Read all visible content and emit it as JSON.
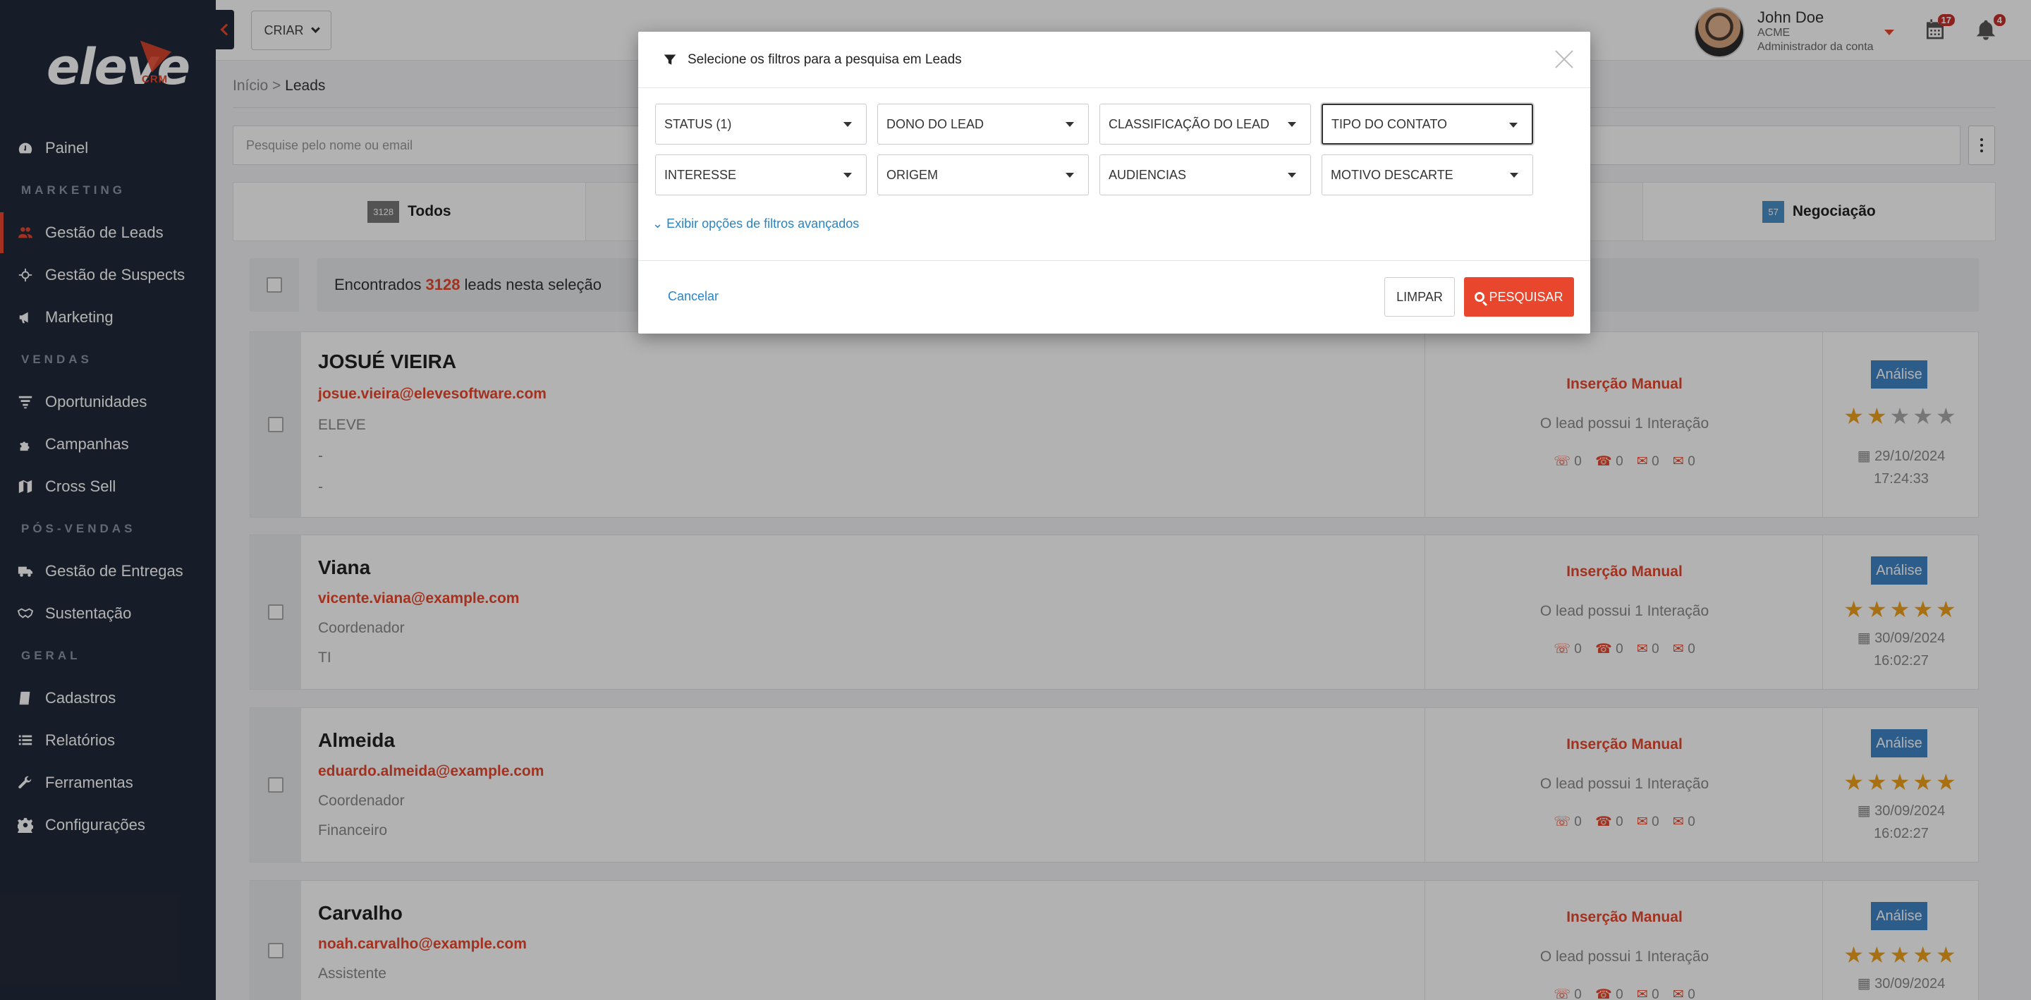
{
  "brand": {
    "name": "eleve",
    "sub": "CRM"
  },
  "sidebar": {
    "sections": [
      "MARKETING",
      "VENDAS",
      "PÓS-VENDAS",
      "GERAL"
    ],
    "items": [
      {
        "label": "Painel",
        "icon": "dashboard-icon"
      },
      {
        "label": "Gestão de Leads",
        "icon": "users-icon"
      },
      {
        "label": "Gestão de Suspects",
        "icon": "crosshair-icon"
      },
      {
        "label": "Marketing",
        "icon": "megaphone-icon"
      },
      {
        "label": "Oportunidades",
        "icon": "filter-icon"
      },
      {
        "label": "Campanhas",
        "icon": "puzzle-icon"
      },
      {
        "label": "Cross Sell",
        "icon": "map-icon"
      },
      {
        "label": "Gestão de Entregas",
        "icon": "truck-icon"
      },
      {
        "label": "Sustentação",
        "icon": "handshake-icon"
      },
      {
        "label": "Cadastros",
        "icon": "book-icon"
      },
      {
        "label": "Relatórios",
        "icon": "list-icon"
      },
      {
        "label": "Ferramentas",
        "icon": "wrench-icon"
      },
      {
        "label": "Configurações",
        "icon": "gear-icon"
      }
    ]
  },
  "topbar": {
    "create_label": "CRIAR",
    "user": {
      "name": "John Doe",
      "company": "ACME",
      "role": "Administrador da conta"
    },
    "calendar_badge": "17",
    "bell_badge": "4"
  },
  "breadcrumb": {
    "home": "Início",
    "sep": ">",
    "current": "Leads"
  },
  "search": {
    "placeholder": "Pesquise pelo nome ou email"
  },
  "tabs": [
    {
      "count": "3128",
      "label": "Todos"
    },
    {
      "count": "57",
      "label": "Negociação"
    }
  ],
  "found": {
    "prefix": "Encontrados",
    "count": "3128",
    "suffix": "leads nesta seleção"
  },
  "leads": [
    {
      "name": "JOSUÉ VIEIRA",
      "email": "josue.vieira@elevesoftware.com",
      "line1": "ELEVE",
      "line2": "-",
      "line3": "-",
      "origin": "Inserção Manual",
      "interactions": "O lead possui 1 Interação",
      "counts": [
        "0",
        "0",
        "0",
        "0"
      ],
      "tag": "Análise",
      "rating": 2,
      "date": "29/10/2024",
      "time": "17:24:33"
    },
    {
      "name": "Viana",
      "email": "vicente.viana@example.com",
      "line1": "Coordenador",
      "line2": "TI",
      "origin": "Inserção Manual",
      "interactions": "O lead possui 1 Interação",
      "counts": [
        "0",
        "0",
        "0",
        "0"
      ],
      "tag": "Análise",
      "rating": 5,
      "date": "30/09/2024",
      "time": "16:02:27"
    },
    {
      "name": "Almeida",
      "email": "eduardo.almeida@example.com",
      "line1": "Coordenador",
      "line2": "Financeiro",
      "origin": "Inserção Manual",
      "interactions": "O lead possui 1 Interação",
      "counts": [
        "0",
        "0",
        "0",
        "0"
      ],
      "tag": "Análise",
      "rating": 5,
      "date": "30/09/2024",
      "time": "16:02:27"
    },
    {
      "name": "Carvalho",
      "email": "noah.carvalho@example.com",
      "line1": "Assistente",
      "origin": "Inserção Manual",
      "interactions": "O lead possui 1 Interação",
      "counts": [
        "0",
        "0",
        "0",
        "0"
      ],
      "tag": "Análise",
      "rating": 5,
      "date": "30/09/2024"
    }
  ],
  "modal": {
    "title": "Selecione os filtros para a pesquisa em Leads",
    "filters": [
      "STATUS (1)",
      "DONO DO LEAD",
      "CLASSIFICAÇÃO DO LEAD",
      "TIPO DO CONTATO",
      "INTERESSE",
      "ORIGEM",
      "AUDIENCIAS",
      "MOTIVO DESCARTE"
    ],
    "advanced_link": "Exibir opções de filtros avançados",
    "cancel": "Cancelar",
    "clear": "LIMPAR",
    "search": "PESQUISAR"
  },
  "colors": {
    "accent": "#e8472d",
    "sidebar": "#222a3a",
    "link": "#2b84c3",
    "tag": "#3f86c6",
    "star": "#f0a11a"
  }
}
